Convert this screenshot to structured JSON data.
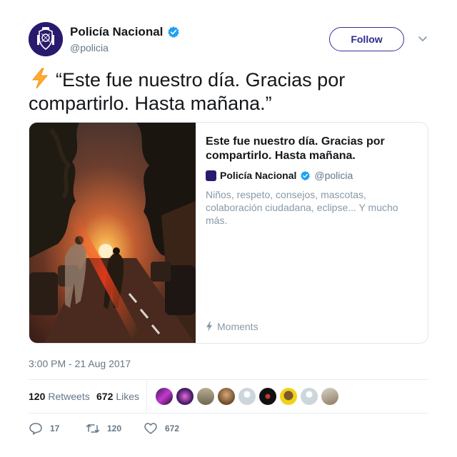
{
  "author": {
    "display_name": "Policía Nacional",
    "handle": "@policia",
    "verified": true,
    "avatar_icon": "police-badge-icon",
    "brand_color": "#2a1a6e"
  },
  "follow_button": {
    "label": "Follow",
    "color": "#2c2a8c"
  },
  "menu": {
    "icon": "chevron-down-icon"
  },
  "tweet": {
    "emoji_icon": "lightning-bolt-icon",
    "text": "“Este fue nuestro día. Gracias por compartirlo. Hasta mañana.”"
  },
  "card": {
    "title": "Este fue nuestro día. Gracias por compartirlo. Hasta mañana.",
    "author_name": "Policía Nacional",
    "author_handle": "@policia",
    "description": "Niños, respeto, consejos, mascotas, colaboración ciudadana, eclipse... Y mucho más.",
    "footer_label": "Moments",
    "footer_icon": "lightning-bolt-icon"
  },
  "timestamp": "3:00 PM - 21 Aug 2017",
  "stats": {
    "retweets_count": "120",
    "retweets_label": "Retweets",
    "likes_count": "672",
    "likes_label": "Likes"
  },
  "actions": {
    "replies": "17",
    "retweets": "120",
    "likes": "672"
  },
  "colors": {
    "verified": "#1da1f2",
    "muted": "#657786",
    "border": "#e1e8ed"
  }
}
